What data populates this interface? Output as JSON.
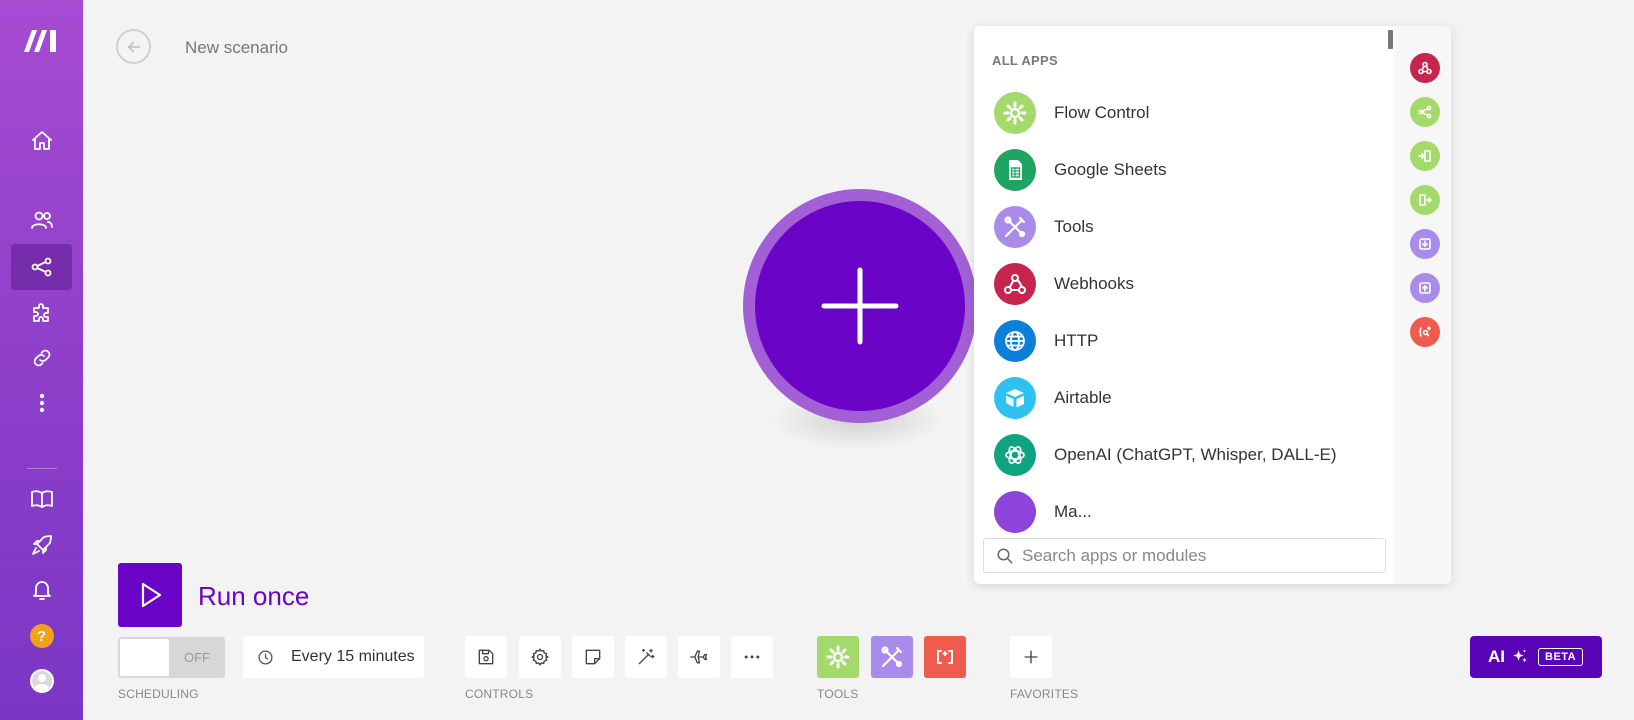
{
  "header": {
    "title": "New scenario"
  },
  "apps_panel": {
    "heading": "ALL APPS",
    "items": [
      {
        "label": "Flow Control",
        "icon": "gear-icon",
        "color": "#a4d96c"
      },
      {
        "label": "Google Sheets",
        "icon": "spreadsheet-icon",
        "color": "#1fa463"
      },
      {
        "label": "Tools",
        "icon": "tools-icon",
        "color": "#a88bea"
      },
      {
        "label": "Webhooks",
        "icon": "webhook-icon",
        "color": "#c7254e"
      },
      {
        "label": "HTTP",
        "icon": "globe-icon",
        "color": "#0b7fd9"
      },
      {
        "label": "Airtable",
        "icon": "airtable-icon",
        "color": "#2ec2f1"
      },
      {
        "label": "OpenAI (ChatGPT, Whisper, DALL-E)",
        "icon": "openai-icon",
        "color": "#10a37f"
      },
      {
        "label": "Ma...",
        "icon": "app-icon",
        "color": "#8e44d8"
      }
    ],
    "search_placeholder": "Search apps or modules",
    "rail_icons": [
      {
        "icon": "webhook-icon",
        "color": "#c7254e"
      },
      {
        "icon": "router-icon",
        "color": "#a4d96c"
      },
      {
        "icon": "aggregator-icon",
        "color": "#a4d96c"
      },
      {
        "icon": "iterator-icon",
        "color": "#a4d96c"
      },
      {
        "icon": "download-icon",
        "color": "#a88bea"
      },
      {
        "icon": "upload-icon",
        "color": "#a88bea"
      },
      {
        "icon": "text-parser-icon",
        "color": "#ef5b4c"
      }
    ]
  },
  "run": {
    "label": "Run once"
  },
  "scheduling": {
    "toggle_label": "OFF",
    "interval": "Every 15 minutes",
    "section_label": "SCHEDULING"
  },
  "controls": {
    "section_label": "CONTROLS"
  },
  "tools": {
    "section_label": "TOOLS"
  },
  "favorites": {
    "section_label": "FAVORITES"
  },
  "ai": {
    "label": "AI",
    "badge": "BETA"
  },
  "colors": {
    "brand_purple": "#6a04c7",
    "sidebar": "#9a45cf",
    "accent_ai": "#5a04b8"
  }
}
